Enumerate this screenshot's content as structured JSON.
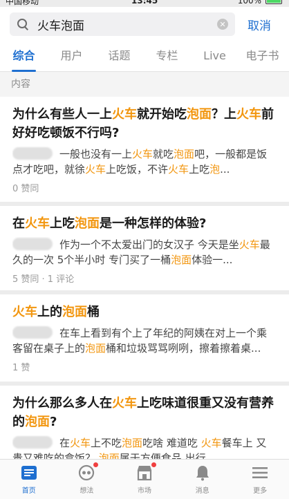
{
  "status_bar": {
    "carrier": "中国移动",
    "time": "13:45",
    "battery": "100%"
  },
  "search": {
    "query": "火车泡面",
    "cancel_label": "取消"
  },
  "tabs": [
    {
      "label": "综合",
      "active": true
    },
    {
      "label": "用户",
      "active": false
    },
    {
      "label": "话题",
      "active": false
    },
    {
      "label": "专栏",
      "active": false
    },
    {
      "label": "Live",
      "active": false
    },
    {
      "label": "电子书",
      "active": false
    }
  ],
  "section_label": "内容",
  "results": [
    {
      "title": "为什么有些人一上<火车>就开始吃<泡面>？上<火车>前好好吃顿饭不行吗?",
      "excerpt": "一般也没有一上<火车>就吃<泡面>吧，一般都是饭点才吃吧，就徐<火车>上吃饭，不许<火车>上吃<泡>...",
      "meta": "0 赞同"
    },
    {
      "title": "在<火车>上吃<泡面>是一种怎样的体验?",
      "excerpt": "作为一个不太爱出门的女汉子 今天是坐<火车>最久的一次 5个半小时 专门买了一桶<泡面>体验一...",
      "meta": "5 赞同 · 1 评论"
    },
    {
      "title": "<火车>上的<泡面>桶",
      "excerpt": "在车上看到有个上了年纪的阿姨在对上一个乘客留在桌子上的<泡面>桶和垃圾骂骂咧咧，擦着擦着桌...",
      "meta": "1 赞"
    },
    {
      "title": "为什么那么多人在<火车>上吃味道很重又没有营养的<泡面>?",
      "excerpt": "在<火车>上不吃<泡面>吃啥 难道吃 <火车>餐车上 又贵又难吃的盒饭？ <泡面>属于方便食品 出行...",
      "meta": ""
    }
  ],
  "bottom_nav": [
    {
      "label": "首页",
      "icon": "home-icon",
      "active": true,
      "badge": false
    },
    {
      "label": "想法",
      "icon": "ideas-icon",
      "active": false,
      "badge": true
    },
    {
      "label": "市场",
      "icon": "market-icon",
      "active": false,
      "badge": true
    },
    {
      "label": "消息",
      "icon": "bell-icon",
      "active": false,
      "badge": false
    },
    {
      "label": "更多",
      "icon": "menu-icon",
      "active": false,
      "badge": false
    }
  ],
  "colors": {
    "accent": "#1e6fd0",
    "highlight": "#f2960f",
    "badge": "#f04040"
  }
}
